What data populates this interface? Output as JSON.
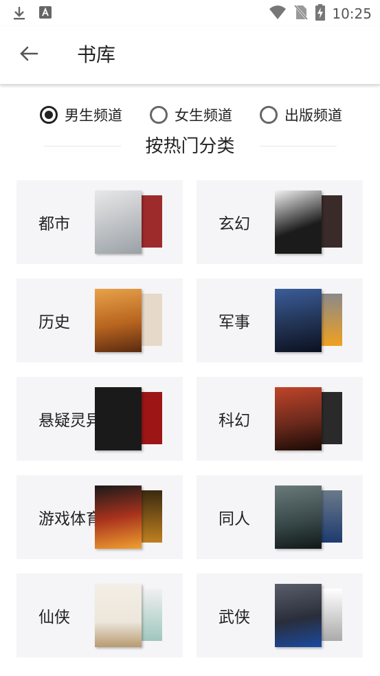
{
  "status_bar": {
    "time": "10:25",
    "icons": [
      "download-icon",
      "font-icon",
      "wifi-icon",
      "no-sim-icon",
      "battery-charging-icon"
    ]
  },
  "app_bar": {
    "back_icon": "arrow-left-icon",
    "title": "书库"
  },
  "channels": [
    {
      "label": "男生频道",
      "selected": true
    },
    {
      "label": "女生频道",
      "selected": false
    },
    {
      "label": "出版频道",
      "selected": false
    }
  ],
  "section_heading": "按热门分类",
  "categories": [
    {
      "label": "都市",
      "colors": [
        "#d8d8d8",
        "#9e2b2b"
      ]
    },
    {
      "label": "玄幻",
      "colors": [
        "#1b1b1b",
        "#3a2a2a"
      ]
    },
    {
      "label": "历史",
      "colors": [
        "#b8651f",
        "#e7d9c9"
      ]
    },
    {
      "label": "军事",
      "colors": [
        "#1f2f4d",
        "#f0a020"
      ]
    },
    {
      "label": "悬疑灵异",
      "colors": [
        "#1a1a1a",
        "#9e1515"
      ]
    },
    {
      "label": "科幻",
      "colors": [
        "#6b2a1c",
        "#2a2a2a"
      ]
    },
    {
      "label": "游戏体育",
      "colors": [
        "#a8321d",
        "#3a2a10"
      ]
    },
    {
      "label": "同人",
      "colors": [
        "#3a4a4a",
        "#1d3b70"
      ]
    },
    {
      "label": "仙侠",
      "colors": [
        "#ece6db",
        "#cfe0da"
      ]
    },
    {
      "label": "武侠",
      "colors": [
        "#2a2d3a",
        "#e8e8e8"
      ]
    }
  ]
}
